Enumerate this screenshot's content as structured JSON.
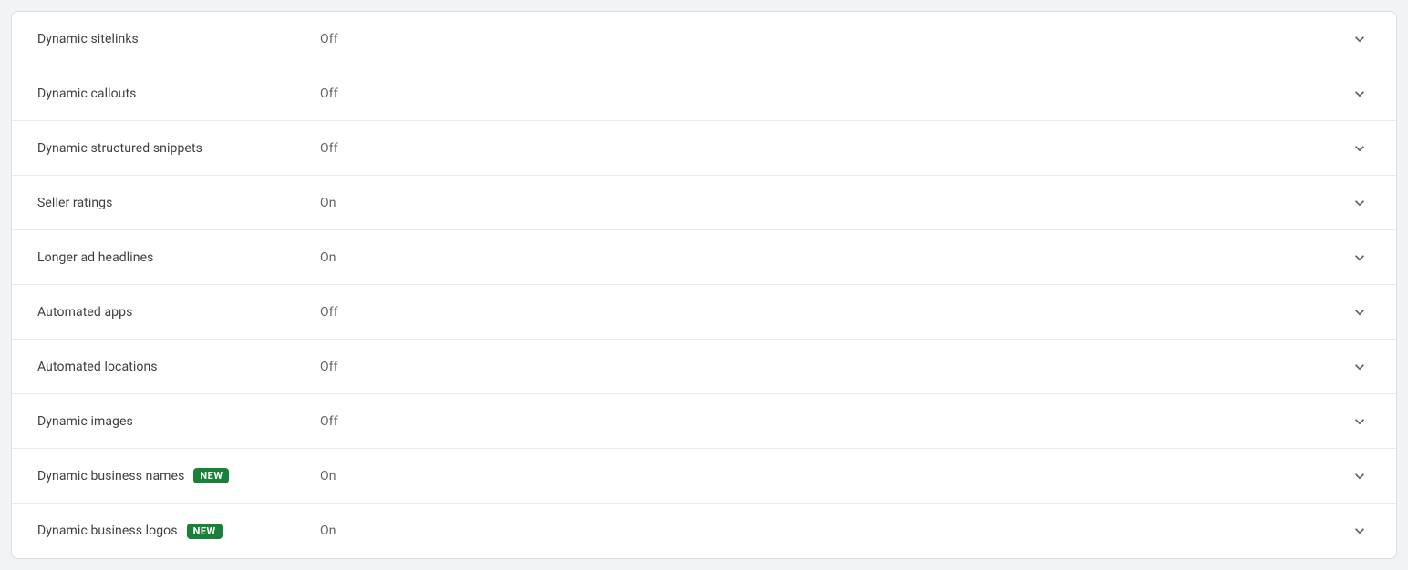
{
  "badge_text": "NEW",
  "settings": [
    {
      "label": "Dynamic sitelinks",
      "status": "Off",
      "badge": false
    },
    {
      "label": "Dynamic callouts",
      "status": "Off",
      "badge": false
    },
    {
      "label": "Dynamic structured snippets",
      "status": "Off",
      "badge": false
    },
    {
      "label": "Seller ratings",
      "status": "On",
      "badge": false
    },
    {
      "label": "Longer ad headlines",
      "status": "On",
      "badge": false
    },
    {
      "label": "Automated apps",
      "status": "Off",
      "badge": false
    },
    {
      "label": "Automated locations",
      "status": "Off",
      "badge": false
    },
    {
      "label": "Dynamic images",
      "status": "Off",
      "badge": false
    },
    {
      "label": "Dynamic business names",
      "status": "On",
      "badge": true
    },
    {
      "label": "Dynamic business logos",
      "status": "On",
      "badge": true
    }
  ]
}
